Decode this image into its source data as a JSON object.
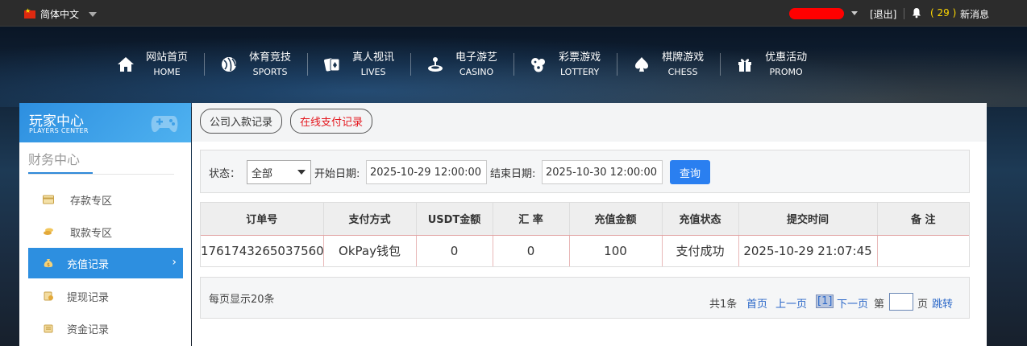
{
  "topbar": {
    "language": "简体中文",
    "logout": "[退出]",
    "message_count": "( 29 )",
    "message_label": "新消息"
  },
  "nav": [
    {
      "zh": "网站首页",
      "en": "HOME",
      "icon": "home-icon"
    },
    {
      "zh": "体育竞技",
      "en": "SPORTS",
      "icon": "ball-icon"
    },
    {
      "zh": "真人视讯",
      "en": "LIVES",
      "icon": "cards-icon"
    },
    {
      "zh": "电子游艺",
      "en": "CASINO",
      "icon": "joystick-icon"
    },
    {
      "zh": "彩票游戏",
      "en": "LOTTERY",
      "icon": "lottery-balls-icon"
    },
    {
      "zh": "棋牌游戏",
      "en": "CHESS",
      "icon": "spade-icon"
    },
    {
      "zh": "优惠活动",
      "en": "PROMO",
      "icon": "gift-icon"
    }
  ],
  "sidebar": {
    "title_zh": "玩家中心",
    "title_en": "PLAYERS CENTER",
    "section": "财务中心",
    "items": [
      {
        "label": "存款专区",
        "icon": "deposit-card-icon"
      },
      {
        "label": "取款专区",
        "icon": "withdraw-coins-icon"
      },
      {
        "label": "充值记录",
        "icon": "money-bag-icon",
        "active": true
      },
      {
        "label": "提现记录",
        "icon": "withdraw-record-icon"
      },
      {
        "label": "资金记录",
        "icon": "funds-record-icon"
      }
    ],
    "active_chevron": "›"
  },
  "tabs": {
    "company_deposit": "公司入款记录",
    "online_payment": "在线支付记录"
  },
  "filter": {
    "status_label": "状态：",
    "status_value": "全部",
    "start_label": "开始日期:",
    "start_value": "2025-10-29 12:00:00",
    "end_label": "结束日期:",
    "end_value": "2025-10-30 12:00:00",
    "query_button": "查询"
  },
  "table": {
    "headers": [
      "订单号",
      "支付方式",
      "USDT金额",
      "汇 率",
      "充值金额",
      "充值状态",
      "提交时间",
      "备 注"
    ],
    "rows": [
      [
        "1761743265037560",
        "OkPay钱包",
        "0",
        "0",
        "100",
        "支付成功",
        "2025-10-29 21:07:45",
        ""
      ]
    ]
  },
  "pager": {
    "per_page": "每页显示20条",
    "total": "共1条",
    "first": "首页",
    "prev": "上一页",
    "current": "[1]",
    "next": "下一页",
    "goto_prefix": "第",
    "goto_suffix": "页",
    "jump": "跳转"
  },
  "colors": {
    "accent_blue": "#2d8fe0",
    "button_blue": "#2a7ff0",
    "tab_red": "#e4171e",
    "message_yellow": "#ffd800",
    "redaction_red": "#ff0000"
  }
}
